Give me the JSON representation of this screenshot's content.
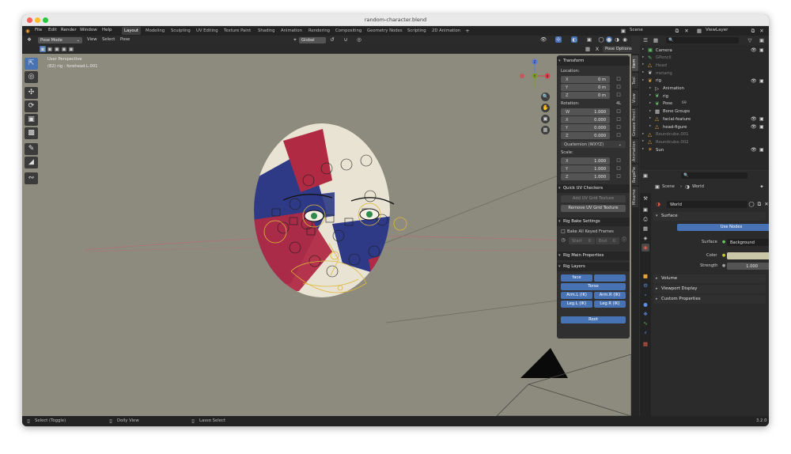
{
  "window": {
    "title": "random-character.blend"
  },
  "menu": {
    "items": [
      "File",
      "Edit",
      "Render",
      "Window",
      "Help"
    ]
  },
  "workspaces": [
    "Layout",
    "Modeling",
    "Sculpting",
    "UV Editing",
    "Texture Paint",
    "Shading",
    "Animation",
    "Rendering",
    "Compositing",
    "Geometry Nodes",
    "Scripting",
    "2D Animation"
  ],
  "active_workspace": "Layout",
  "topbar": {
    "scene_label": "Scene",
    "viewlayer_label": "ViewLayer"
  },
  "viewport_header": {
    "mode": "Pose Mode",
    "menus": [
      "View",
      "Select",
      "Pose"
    ],
    "orientation": "Global",
    "pose_options": "Pose Options"
  },
  "viewport": {
    "perspective": "User Perspective",
    "active_object": "(82) rig : forehead.L.001",
    "gizmo_labels": {
      "z": "Z",
      "y": "Y",
      "x": "X"
    }
  },
  "npanel": {
    "transform_title": "Transform",
    "location_label": "Location:",
    "location": [
      {
        "axis": "X",
        "value": "0 m"
      },
      {
        "axis": "Y",
        "value": "0 m"
      },
      {
        "axis": "Z",
        "value": "0 m"
      }
    ],
    "rotation_label": "Rotation:",
    "rotation_mode_short": "4L",
    "rotation": [
      {
        "axis": "W",
        "value": "1.000"
      },
      {
        "axis": "X",
        "value": "0.000"
      },
      {
        "axis": "Y",
        "value": "0.000"
      },
      {
        "axis": "Z",
        "value": "0.000"
      }
    ],
    "rotation_mode": "Quaternion (WXYZ)",
    "scale_label": "Scale:",
    "scale": [
      {
        "axis": "X",
        "value": "1.000"
      },
      {
        "axis": "Y",
        "value": "1.000"
      },
      {
        "axis": "Z",
        "value": "1.000"
      }
    ],
    "uv_title": "Quick UV Checkers",
    "add_uv": "Add UV Grid Texture",
    "remove_uv": "Remove UV Grid Texture",
    "bake_title": "Rig Bake Settings",
    "bake_all": "Bake All Keyed Frames",
    "start_label": "Start",
    "start_value": "0",
    "end_label": "End",
    "end_value": "0",
    "main_props_title": "Rig Main Properties",
    "layers_title": "Rig Layers",
    "layers": {
      "face": "face",
      "torso": "Torso",
      "arm_l": "Arm.L (IK)",
      "arm_r": "Arm.R (IK)",
      "leg_l": "Leg.L (IK)",
      "leg_r": "Leg.R (IK)",
      "root": "Root"
    }
  },
  "side_tabs": [
    "Item",
    "Tool",
    "View",
    "Grease Pencil",
    "Animation",
    "BagaPie",
    "Mixamo"
  ],
  "outliner": {
    "rows": [
      {
        "name": "Camera",
        "dim": false
      },
      {
        "name": "GPencil",
        "dim": true
      },
      {
        "name": "Head",
        "dim": true
      },
      {
        "name": "metarig",
        "dim": true
      },
      {
        "name": "rig",
        "dim": false
      },
      {
        "name": "Animation",
        "dim": false
      },
      {
        "name": "rig",
        "dim": false
      },
      {
        "name": "Pose",
        "dim": false
      },
      {
        "name": "Bone Groups",
        "dim": false
      },
      {
        "name": "facial-feature",
        "dim": false
      },
      {
        "name": "head-figure",
        "dim": false
      },
      {
        "name": "Roundcube.001",
        "dim": true
      },
      {
        "name": "Roundcube.002",
        "dim": true
      },
      {
        "name": "Sun",
        "dim": false
      }
    ],
    "pose_badge": "69"
  },
  "properties": {
    "breadcrumb_scene": "Scene",
    "breadcrumb_world": "World",
    "world_name": "World",
    "surface_title": "Surface",
    "use_nodes": "Use Nodes",
    "surface_label": "Surface",
    "surface_value": "Background",
    "color_label": "Color",
    "color_value": "#c9c7a8",
    "strength_label": "Strength",
    "strength_value": "1.000",
    "volume_title": "Volume",
    "viewport_display_title": "Viewport Display",
    "custom_props_title": "Custom Properties"
  },
  "statusbar": {
    "select": "Select (Toggle)",
    "dolly": "Dolly View",
    "lasso": "Lasso Select",
    "version": "3.2.0"
  }
}
